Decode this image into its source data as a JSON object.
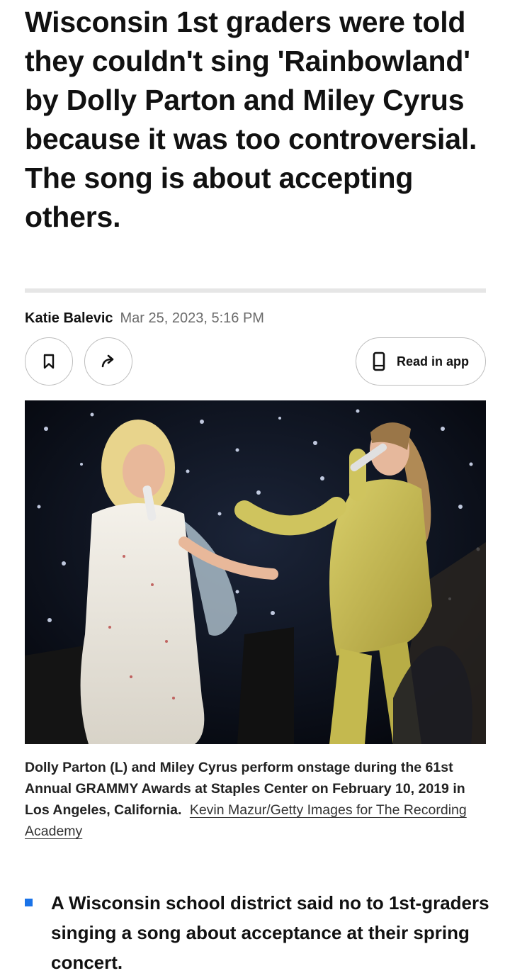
{
  "article": {
    "headline": "Wisconsin 1st graders were told they couldn't sing 'Rainbowland' by Dolly Parton and Miley Cyrus because it was too controversial. The song is about accepting others.",
    "author": "Katie Balevic",
    "date": "Mar 25, 2023, 5:16 PM"
  },
  "actions": {
    "bookmark_icon": "bookmark-icon",
    "share_icon": "share-arrow-icon",
    "read_in_app_label": "Read in app",
    "phone_icon": "phone-icon"
  },
  "image": {
    "caption": "Dolly Parton (L) and Miley Cyrus perform onstage during the 61st Annual GRAMMY Awards at Staples Center on February 10, 2019 in Los Angeles, California.",
    "credit": "Kevin Mazur/Getty Images for The Recording Academy"
  },
  "bullets": [
    "A Wisconsin school district said no to 1st-graders singing a song about acceptance at their spring concert."
  ],
  "colors": {
    "bullet_accent": "#1a73e8",
    "divider": "#e6e6e6",
    "date_text": "#6b6b6b"
  }
}
